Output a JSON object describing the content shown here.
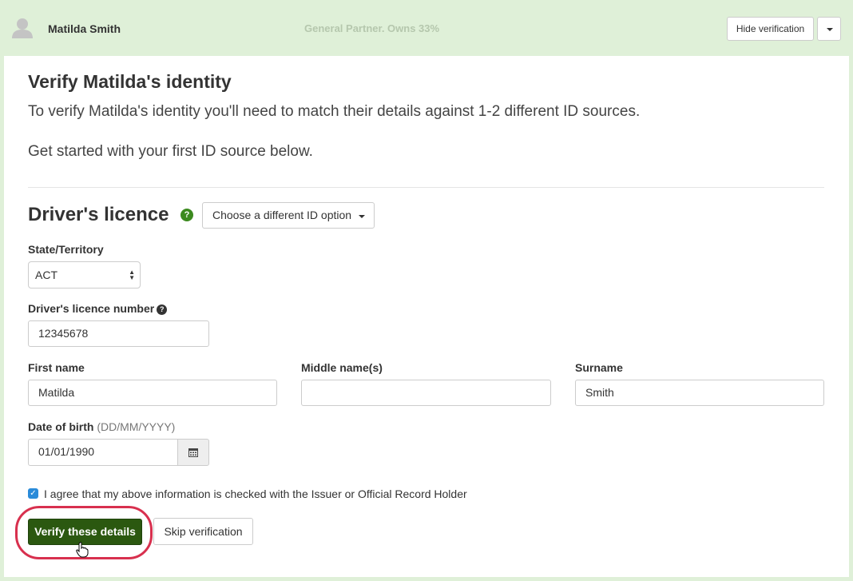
{
  "header": {
    "person_name": "Matilda Smith",
    "role": "General Partner. Owns 33%",
    "hide_button": "Hide verification"
  },
  "main": {
    "title": "Verify Matilda's identity",
    "intro": "To verify Matilda's identity you'll need to match their details against 1-2 different ID sources.",
    "intro2": "Get started with your first ID source below.",
    "section_title": "Driver's licence",
    "id_option_button": "Choose a different ID option"
  },
  "form": {
    "state_label": "State/Territory",
    "state_value": "ACT",
    "licence_label": "Driver's licence number",
    "licence_value": "12345678",
    "first_name_label": "First name",
    "first_name_value": "Matilda",
    "middle_name_label": "Middle name(s)",
    "middle_name_value": "",
    "surname_label": "Surname",
    "surname_value": "Smith",
    "dob_label": "Date of birth",
    "dob_hint": "(DD/MM/YYYY)",
    "dob_value": "01/01/1990",
    "agree_text": "I agree that my above information is checked with the Issuer or Official Record Holder",
    "agree_checked": true
  },
  "actions": {
    "verify_button": "Verify these details",
    "skip_button": "Skip verification"
  },
  "colors": {
    "header_bg": "#dff0d8",
    "primary_button": "#2b5810",
    "highlight_ring": "#d8304e",
    "checkbox": "#2a8bd9"
  }
}
